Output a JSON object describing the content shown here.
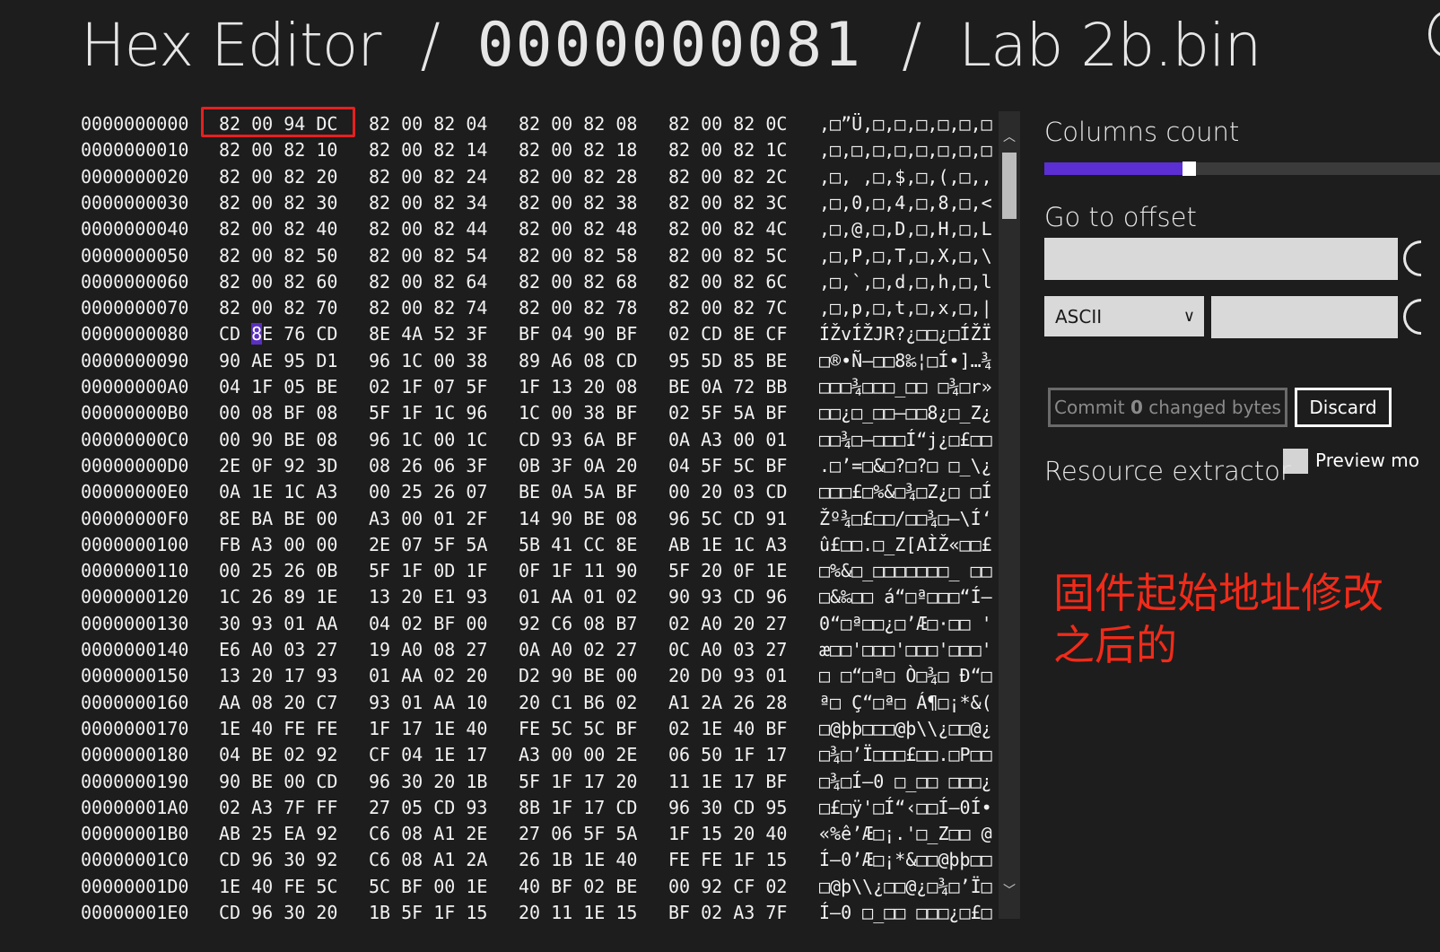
{
  "header": {
    "app_name": "Hex Editor",
    "separator": "/",
    "offset": "0000000081",
    "file_name": "Lab 2b.bin"
  },
  "hex_rows": [
    {
      "addr": "0000000000",
      "g0": "82 00 94 DC",
      "g1": "82 00 82 04",
      "g2": "82 00 82 08",
      "g3": "82 00 82 0C",
      "text": ",□”Ü,□,□,□,□,□,□"
    },
    {
      "addr": "0000000010",
      "g0": "82 00 82 10",
      "g1": "82 00 82 14",
      "g2": "82 00 82 18",
      "g3": "82 00 82 1C",
      "text": ",□,□,□,□,□,□,□,□"
    },
    {
      "addr": "0000000020",
      "g0": "82 00 82 20",
      "g1": "82 00 82 24",
      "g2": "82 00 82 28",
      "g3": "82 00 82 2C",
      "text": ",□, ,□,$,□,(,□,,"
    },
    {
      "addr": "0000000030",
      "g0": "82 00 82 30",
      "g1": "82 00 82 34",
      "g2": "82 00 82 38",
      "g3": "82 00 82 3C",
      "text": ",□,0,□,4,□,8,□,<"
    },
    {
      "addr": "0000000040",
      "g0": "82 00 82 40",
      "g1": "82 00 82 44",
      "g2": "82 00 82 48",
      "g3": "82 00 82 4C",
      "text": ",□,@,□,D,□,H,□,L"
    },
    {
      "addr": "0000000050",
      "g0": "82 00 82 50",
      "g1": "82 00 82 54",
      "g2": "82 00 82 58",
      "g3": "82 00 82 5C",
      "text": ",□,P,□,T,□,X,□,\\"
    },
    {
      "addr": "0000000060",
      "g0": "82 00 82 60",
      "g1": "82 00 82 64",
      "g2": "82 00 82 68",
      "g3": "82 00 82 6C",
      "text": ",□,`,□,d,□,h,□,l"
    },
    {
      "addr": "0000000070",
      "g0": "82 00 82 70",
      "g1": "82 00 82 74",
      "g2": "82 00 82 78",
      "g3": "82 00 82 7C",
      "text": ",□,p,□,t,□,x,□,|"
    },
    {
      "addr": "0000000080",
      "g0_a": "CD ",
      "g0_cursor": "8",
      "g0_b": "E 76 CD",
      "g1": "8E 4A 52 3F",
      "g2": "BF 04 90 BF",
      "g3": "02 CD 8E CF",
      "text": "ÍŽvÍŽJR?¿□□¿□ÍŽÏ"
    },
    {
      "addr": "0000000090",
      "g0": "90 AE 95 D1",
      "g1": "96 1C 00 38",
      "g2": "89 A6 08 CD",
      "g3": "95 5D 85 BE",
      "text": "□®•Ñ–□□8‰¦□Í•]…¾"
    },
    {
      "addr": "00000000A0",
      "g0": "04 1F 05 BE",
      "g1": "02 1F 07 5F",
      "g2": "1F 13 20 08",
      "g3": "BE 0A 72 BB",
      "text": "□□□¾□□□_□□ □¾□r»"
    },
    {
      "addr": "00000000B0",
      "g0": "00 08 BF 08",
      "g1": "5F 1F 1C 96",
      "g2": "1C 00 38 BF",
      "g3": "02 5F 5A BF",
      "text": "□□¿□_□□–□□8¿□_Z¿"
    },
    {
      "addr": "00000000C0",
      "g0": "00 90 BE 08",
      "g1": "96 1C 00 1C",
      "g2": "CD 93 6A BF",
      "g3": "0A A3 00 01",
      "text": "□□¾□–□□□Í“j¿□£□□"
    },
    {
      "addr": "00000000D0",
      "g0": "2E 0F 92 3D",
      "g1": "08 26 06 3F",
      "g2": "0B 3F 0A 20",
      "g3": "04 5F 5C BF",
      "text": ".□’=□&□?□?□ □_\\¿"
    },
    {
      "addr": "00000000E0",
      "g0": "0A 1E 1C A3",
      "g1": "00 25 26 07",
      "g2": "BE 0A 5A BF",
      "g3": "00 20 03 CD",
      "text": "□□□£□%&□¾□Z¿□ □Í"
    },
    {
      "addr": "00000000F0",
      "g0": "8E BA BE 00",
      "g1": "A3 00 01 2F",
      "g2": "14 90 BE 08",
      "g3": "96 5C CD 91",
      "text": "Žº¾□£□□/□□¾□–\\Í‘"
    },
    {
      "addr": "0000000100",
      "g0": "FB A3 00 00",
      "g1": "2E 07 5F 5A",
      "g2": "5B 41 CC 8E",
      "g3": "AB 1E 1C A3",
      "text": "û£□□.□_Z[AÌŽ«□□£"
    },
    {
      "addr": "0000000110",
      "g0": "00 25 26 0B",
      "g1": "5F 1F 0D 1F",
      "g2": "0F 1F 11 90",
      "g3": "5F 20 0F 1E",
      "text": "□%&□_□□□□□□□_ □□"
    },
    {
      "addr": "0000000120",
      "g0": "1C 26 89 1E",
      "g1": "13 20 E1 93",
      "g2": "01 AA 01 02",
      "g3": "90 93 CD 96",
      "text": "□&‰□□ á“□ª□□□“Í–"
    },
    {
      "addr": "0000000130",
      "g0": "30 93 01 AA",
      "g1": "04 02 BF 00",
      "g2": "92 C6 08 B7",
      "g3": "02 A0 20 27",
      "text": "0“□ª□□¿□’Æ□·□□ '"
    },
    {
      "addr": "0000000140",
      "g0": "E6 A0 03 27",
      "g1": "19 A0 08 27",
      "g2": "0A A0 02 27",
      "g3": "0C A0 03 27",
      "text": "æ□□'□□□'□□□'□□□'"
    },
    {
      "addr": "0000000150",
      "g0": "13 20 17 93",
      "g1": "01 AA 02 20",
      "g2": "D2 90 BE 00",
      "g3": "20 D0 93 01",
      "text": "□ □“□ª□ Ò□¾□ Ð“□"
    },
    {
      "addr": "0000000160",
      "g0": "AA 08 20 C7",
      "g1": "93 01 AA 10",
      "g2": "20 C1 B6 02",
      "g3": "A1 2A 26 28",
      "text": "ª□ Ç“□ª□ Á¶□¡*&("
    },
    {
      "addr": "0000000170",
      "g0": "1E 40 FE FE",
      "g1": "1F 17 1E 40",
      "g2": "FE 5C 5C BF",
      "g3": "02 1E 40 BF",
      "text": "□@þþ□□□@þ\\\\¿□□@¿"
    },
    {
      "addr": "0000000180",
      "g0": "04 BE 02 92",
      "g1": "CF 04 1E 17",
      "g2": "A3 00 00 2E",
      "g3": "06 50 1F 17",
      "text": "□¾□’Ï□□□£□□.□P□□"
    },
    {
      "addr": "0000000190",
      "g0": "90 BE 00 CD",
      "g1": "96 30 20 1B",
      "g2": "5F 1F 17 20",
      "g3": "11 1E 17 BF",
      "text": "□¾□Í–0 □_□□ □□□¿"
    },
    {
      "addr": "00000001A0",
      "g0": "02 A3 7F FF",
      "g1": "27 05 CD 93",
      "g2": "8B 1F 17 CD",
      "g3": "96 30 CD 95",
      "text": "□£□ÿ'□Í“‹□□Í–0Í•"
    },
    {
      "addr": "00000001B0",
      "g0": "AB 25 EA 92",
      "g1": "C6 08 A1 2E",
      "g2": "27 06 5F 5A",
      "g3": "1F 15 20 40",
      "text": "«%ê’Æ□¡.'□_Z□□ @"
    },
    {
      "addr": "00000001C0",
      "g0": "CD 96 30 92",
      "g1": "C6 08 A1 2A",
      "g2": "26 1B 1E 40",
      "g3": "FE FE 1F 15",
      "text": "Í–0’Æ□¡*&□□@þþ□□"
    },
    {
      "addr": "00000001D0",
      "g0": "1E 40 FE 5C",
      "g1": "5C BF 00 1E",
      "g2": "40 BF 02 BE",
      "g3": "00 92 CF 02",
      "text": "□@þ\\\\¿□□@¿□¾□’Ï□"
    },
    {
      "addr": "00000001E0",
      "g0": "CD 96 30 20",
      "g1": "1B 5F 1F 15",
      "g2": "20 11 1E 15",
      "g3": "BF 02 A3 7F",
      "text": "Í–0 □_□□ □□□¿□£□"
    }
  ],
  "panel": {
    "columns_count_label": "Columns count",
    "columns_count_fraction": 0.35,
    "go_to_offset_label": "Go to offset",
    "offset_value": "",
    "encoding_selected": "ASCII",
    "search_value": "",
    "commit_prefix": "Commit ",
    "commit_count": "0",
    "commit_suffix": " changed bytes",
    "discard_label": "Discard",
    "resource_extractor_label": "Resource extractor",
    "preview_label": "Preview mo"
  },
  "annotation": {
    "text": "固件起始地址修改之后的",
    "color": "#f02b1a"
  },
  "colors": {
    "accent": "#5b2fd4",
    "background": "#1d1d1d",
    "highlight_box": "#e62020"
  },
  "icons": {
    "dropdown": "chevron-down-icon",
    "scroll_up": "scroll-up-icon",
    "scroll_down": "scroll-down-icon"
  }
}
